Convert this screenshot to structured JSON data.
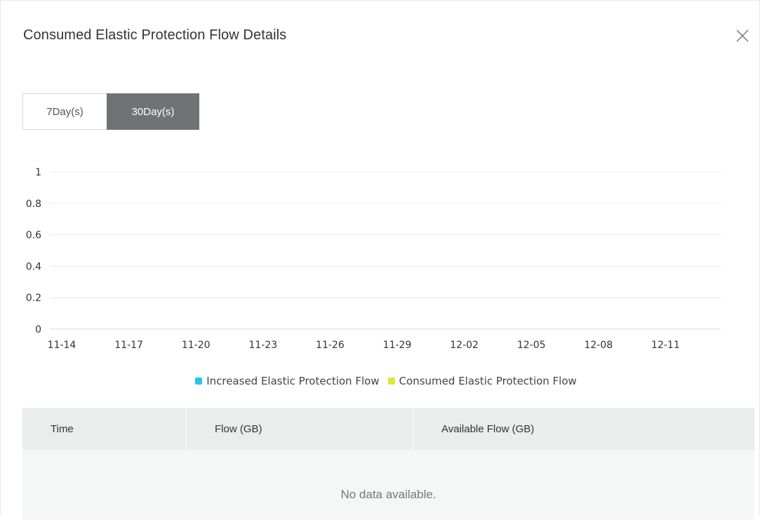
{
  "dialog": {
    "title": "Consumed Elastic Protection Flow Details",
    "close_icon": "close-icon"
  },
  "tabs": [
    {
      "label": "7Day(s)",
      "active": false
    },
    {
      "label": "30Day(s)",
      "active": true
    }
  ],
  "chart_data": {
    "type": "line",
    "x": [
      "11-14",
      "11-17",
      "11-20",
      "11-23",
      "11-26",
      "11-29",
      "12-02",
      "12-05",
      "12-08",
      "12-11"
    ],
    "yticks": [
      "1",
      "0.8",
      "0.6",
      "0.4",
      "0.2",
      "0"
    ],
    "ylim": [
      0,
      1
    ],
    "grid": true,
    "legend_placement": "bottom",
    "series": [
      {
        "name": "Increased Elastic Protection Flow",
        "color": "#22c6e8",
        "values": []
      },
      {
        "name": "Consumed Elastic Protection Flow",
        "color": "#dde83a",
        "values": []
      }
    ]
  },
  "table": {
    "columns": [
      "Time",
      "Flow (GB)",
      "Available Flow (GB)"
    ],
    "empty_text": "No data available."
  }
}
